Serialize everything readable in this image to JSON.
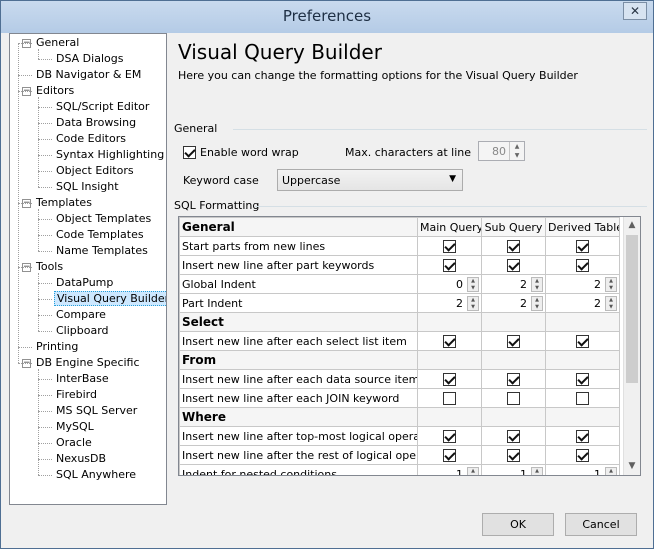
{
  "window": {
    "title": "Preferences",
    "close_glyph": "✕"
  },
  "tree": {
    "items": [
      {
        "label": "General",
        "level": 0,
        "expander": "−"
      },
      {
        "label": "DSA Dialogs",
        "level": 1
      },
      {
        "label": "DB Navigator & EM",
        "level": 0
      },
      {
        "label": "Editors",
        "level": 0,
        "expander": "−"
      },
      {
        "label": "SQL/Script Editor",
        "level": 1
      },
      {
        "label": "Data Browsing",
        "level": 1
      },
      {
        "label": "Code Editors",
        "level": 1
      },
      {
        "label": "Syntax Highlighting",
        "level": 1
      },
      {
        "label": "Object Editors",
        "level": 1
      },
      {
        "label": "SQL Insight",
        "level": 1
      },
      {
        "label": "Templates",
        "level": 0,
        "expander": "−"
      },
      {
        "label": "Object Templates",
        "level": 1
      },
      {
        "label": "Code Templates",
        "level": 1
      },
      {
        "label": "Name Templates",
        "level": 1
      },
      {
        "label": "Tools",
        "level": 0,
        "expander": "−"
      },
      {
        "label": "DataPump",
        "level": 1
      },
      {
        "label": "Visual Query Builder",
        "level": 1,
        "selected": true
      },
      {
        "label": "Compare",
        "level": 1
      },
      {
        "label": "Clipboard",
        "level": 1
      },
      {
        "label": "Printing",
        "level": 0
      },
      {
        "label": "DB Engine Specific",
        "level": 0,
        "expander": "−"
      },
      {
        "label": "InterBase",
        "level": 1
      },
      {
        "label": "Firebird",
        "level": 1
      },
      {
        "label": "MS SQL Server",
        "level": 1
      },
      {
        "label": "MySQL",
        "level": 1
      },
      {
        "label": "Oracle",
        "level": 1
      },
      {
        "label": "NexusDB",
        "level": 1
      },
      {
        "label": "SQL Anywhere",
        "level": 1
      }
    ]
  },
  "page": {
    "title": "Visual Query Builder",
    "subtitle": "Here you can change the formatting options for the Visual Query Builder",
    "general_section": "General",
    "word_wrap_label": "Enable word wrap",
    "word_wrap_checked": true,
    "max_chars_label": "Max. characters at line",
    "max_chars_value": "80",
    "keyword_case_label": "Keyword case",
    "keyword_case_value": "Uppercase",
    "sql_formatting_section": "SQL Formatting"
  },
  "grid": {
    "columns": [
      "General",
      "Main Query",
      "Sub Query",
      "Derived Table"
    ],
    "rows": [
      {
        "label": "Start parts from new lines",
        "type": "check",
        "values": [
          true,
          true,
          true
        ]
      },
      {
        "label": "Insert new line after part keywords",
        "type": "check",
        "values": [
          true,
          true,
          true
        ]
      },
      {
        "label": "Global Indent",
        "type": "num",
        "values": [
          "0",
          "2",
          "2"
        ]
      },
      {
        "label": "Part Indent",
        "type": "num",
        "values": [
          "2",
          "2",
          "2"
        ]
      },
      {
        "label": "Select",
        "type": "header"
      },
      {
        "label": "Insert new line after each select list item",
        "type": "check",
        "values": [
          true,
          true,
          true
        ]
      },
      {
        "label": "From",
        "type": "header"
      },
      {
        "label": "Insert new line after each data source item",
        "type": "check",
        "values": [
          true,
          true,
          true
        ]
      },
      {
        "label": "Insert new line after each JOIN keyword",
        "type": "check",
        "values": [
          false,
          false,
          false
        ]
      },
      {
        "label": "Where",
        "type": "header"
      },
      {
        "label": "Insert new line after top-most logical operators",
        "type": "check",
        "values": [
          true,
          true,
          true
        ]
      },
      {
        "label": "Insert new line after the rest of logical operators",
        "type": "check",
        "values": [
          true,
          true,
          true
        ]
      },
      {
        "label": "Indent for nested conditions",
        "type": "num",
        "values": [
          "1",
          "1",
          "1"
        ]
      }
    ]
  },
  "buttons": {
    "ok": "OK",
    "cancel": "Cancel"
  }
}
